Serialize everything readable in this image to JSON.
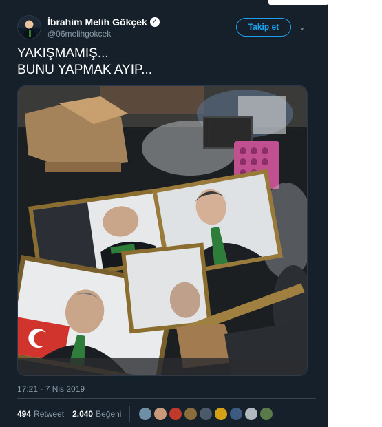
{
  "tweet": {
    "display_name": "İbrahim Melih Gökçek",
    "handle": "@06melihgokcek",
    "follow_label": "Takip et",
    "text_line1": "YAKIŞMAMIŞ...",
    "text_line2": "BUNU YAPMAK AYIP...",
    "timestamp": "17:21 - 7 Nis 2019",
    "retweet_count": "494",
    "retweet_label": "Retweet",
    "like_count": "2.040",
    "like_label": "Beğeni",
    "verified_icon": "verified-check-icon",
    "caret_icon": "chevron-down-icon"
  },
  "colors": {
    "background": "#15202b",
    "accent": "#1da1f2",
    "muted": "#8899a6"
  },
  "likers": [
    {
      "name": "liker-avatar-1",
      "color": "#6f8fa6"
    },
    {
      "name": "liker-avatar-2",
      "color": "#c89a7a"
    },
    {
      "name": "liker-avatar-3",
      "color": "#c0392b"
    },
    {
      "name": "liker-avatar-4",
      "color": "#8a6d3b"
    },
    {
      "name": "liker-avatar-5",
      "color": "#4a5a6a"
    },
    {
      "name": "liker-avatar-6",
      "color": "#d4a017"
    },
    {
      "name": "liker-avatar-7",
      "color": "#3d5a80"
    },
    {
      "name": "liker-avatar-8",
      "color": "#b0b8c0"
    },
    {
      "name": "liker-avatar-9",
      "color": "#5a7a4a"
    }
  ]
}
